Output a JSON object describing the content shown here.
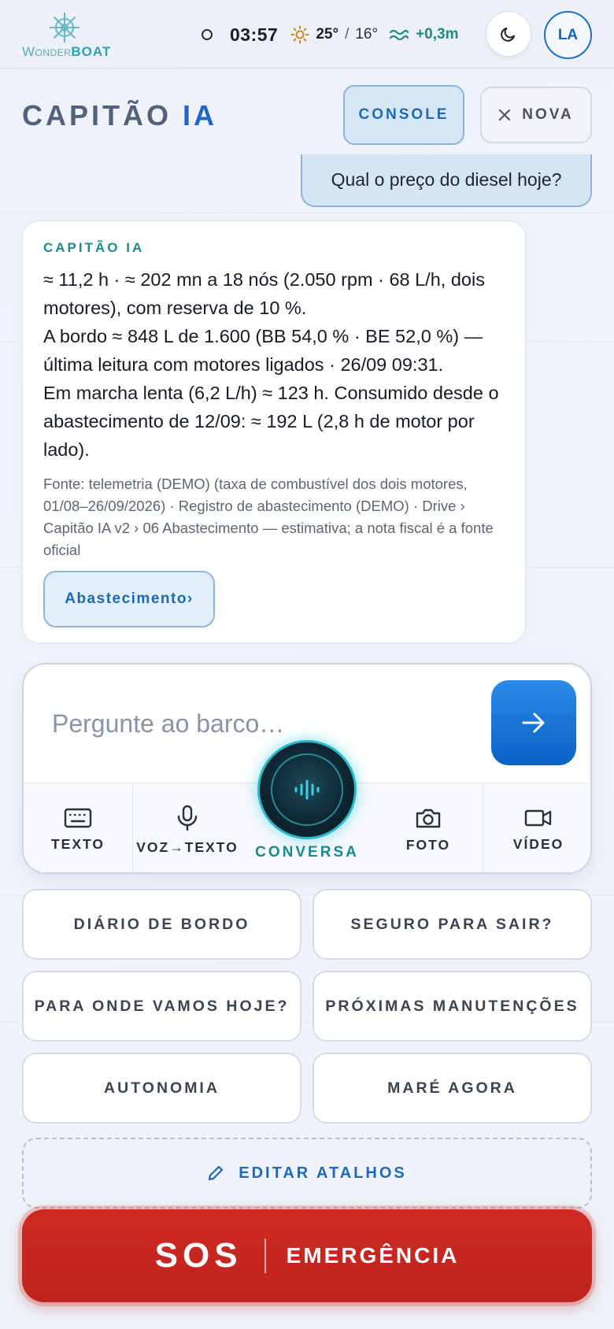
{
  "app": {
    "logo_word_1": "Wonder",
    "logo_word_2": "BOAT"
  },
  "status": {
    "time": "03:57",
    "temp_high": "25°",
    "separator": "/",
    "temp_low": "16°",
    "tide": "+0,3m",
    "icons": [
      "status-dot-icon",
      "sun-icon",
      "wave-icon",
      "moon-icon"
    ]
  },
  "user": {
    "initials": "LA"
  },
  "header": {
    "title_part_1": "CAPITÃO",
    "title_part_2": "IA",
    "console_label": "CONSOLE",
    "nova_label": "NOVA"
  },
  "chat": {
    "user_message": "Qual o preço do diesel hoje?",
    "assistant": {
      "label": "CAPITÃO IA",
      "paragraphs": [
        "≈ 11,2 h · ≈ 202 mn a 18 nós (2.050 rpm · 68 L/h, dois motores), com reserva de 10 %.",
        "A bordo ≈ 848 L de 1.600 (BB 54,0 % · BE 52,0 %) — última leitura com motores ligados · 26/09 09:31.",
        "Em marcha lenta (6,2 L/h) ≈ 123 h. Consumido desde o abastecimento de 12/09: ≈ 192 L (2,8 h de motor por lado)."
      ],
      "source": "Fonte: telemetria (DEMO) (taxa de combustível dos dois motores, 01/08–26/09/2026) · Registro de abastecimento (DEMO) · Drive › Capitão IA v2 › 06 Abastecimento — estimativa; a nota fiscal é a fonte oficial",
      "chip_label": "Abastecimento›"
    }
  },
  "composer": {
    "placeholder": "Pergunte ao barco…",
    "modes": [
      {
        "label": "TEXTO",
        "icon": "keyboard-icon"
      },
      {
        "label": "VOZ→TEXTO",
        "icon": "microphone-icon"
      },
      {
        "label": "CONVERSA",
        "icon": "voice-wave-icon"
      },
      {
        "label": "FOTO",
        "icon": "camera-icon"
      },
      {
        "label": "VÍDEO",
        "icon": "video-icon"
      }
    ]
  },
  "shortcuts": [
    "DIÁRIO DE BORDO",
    "SEGURO PARA SAIR?",
    "PARA ONDE VAMOS HOJE?",
    "PRÓXIMAS MANUTENÇÕES",
    "AUTONOMIA",
    "MARÉ AGORA"
  ],
  "edit_shortcuts_label": "EDITAR ATALHOS",
  "sos": {
    "main": "SOS",
    "sub": "EMERGÊNCIA"
  },
  "colors": {
    "accent_blue": "#1e67c9",
    "teal": "#1f8a88",
    "sos_red": "#cf2a22"
  }
}
